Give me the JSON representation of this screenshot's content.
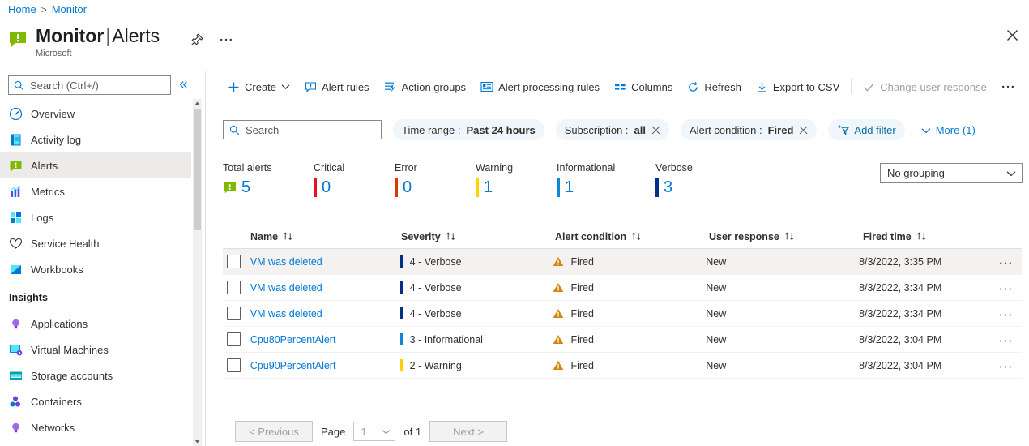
{
  "breadcrumb": {
    "home": "Home",
    "separator": ">",
    "current": "Monitor"
  },
  "header": {
    "title_main": "Monitor",
    "title_divider": "|",
    "title_sub": "Alerts",
    "subtitle": "Microsoft",
    "pin_icon": "pin-icon",
    "more_icon": "ellipsis-icon",
    "close_icon": "close-icon",
    "app_icon": "alert-green-icon"
  },
  "sidebar": {
    "search": {
      "placeholder": "Search (Ctrl+/)",
      "value": "",
      "icon": "search-icon"
    },
    "collapse_icon": "chevron-double-left-icon",
    "items": [
      {
        "label": "Overview",
        "icon": "overview-gauge-icon",
        "selected": false
      },
      {
        "label": "Activity log",
        "icon": "activity-log-book-icon",
        "selected": false
      },
      {
        "label": "Alerts",
        "icon": "alerts-green-icon",
        "selected": true
      },
      {
        "label": "Metrics",
        "icon": "metrics-chart-icon",
        "selected": false
      },
      {
        "label": "Logs",
        "icon": "logs-blocks-icon",
        "selected": false
      },
      {
        "label": "Service Health",
        "icon": "heart-pulse-icon",
        "selected": false
      },
      {
        "label": "Workbooks",
        "icon": "workbooks-icon",
        "selected": false
      }
    ],
    "section_label": "Insights",
    "insights": [
      {
        "label": "Applications",
        "icon": "application-bulb-icon"
      },
      {
        "label": "Virtual Machines",
        "icon": "virtual-machine-icon"
      },
      {
        "label": "Storage accounts",
        "icon": "storage-account-icon"
      },
      {
        "label": "Containers",
        "icon": "containers-icon"
      },
      {
        "label": "Networks",
        "icon": "networks-bulb-icon"
      }
    ]
  },
  "commandbar": [
    {
      "label": "Create",
      "icon": "plus-icon",
      "caret": true,
      "disabled": false
    },
    {
      "label": "Alert rules",
      "icon": "alert-rules-icon",
      "caret": false,
      "disabled": false
    },
    {
      "label": "Action groups",
      "icon": "action-groups-icon",
      "caret": false,
      "disabled": false
    },
    {
      "label": "Alert processing rules",
      "icon": "alert-processing-rules-icon",
      "caret": false,
      "disabled": false
    },
    {
      "label": "Columns",
      "icon": "columns-icon",
      "caret": false,
      "disabled": false
    },
    {
      "label": "Refresh",
      "icon": "refresh-icon",
      "caret": false,
      "disabled": false
    },
    {
      "label": "Export to CSV",
      "icon": "download-icon",
      "caret": false,
      "disabled": false
    },
    {
      "label": "Change user response",
      "icon": "checkmark-icon",
      "caret": false,
      "disabled": true
    }
  ],
  "commandbar_overflow_icon": "ellipsis-icon",
  "filters": {
    "search": {
      "placeholder": "Search",
      "value": "",
      "icon": "search-icon"
    },
    "pills": [
      {
        "key": "Time range :",
        "value": "Past 24 hours",
        "removable": false
      },
      {
        "key": "Subscription :",
        "value": "all",
        "removable": true
      },
      {
        "key": "Alert condition :",
        "value": "Fired",
        "removable": true
      }
    ],
    "add_filter": {
      "label": "Add filter",
      "icon": "add-filter-icon"
    },
    "more": {
      "label": "More (1)",
      "icon": "chevron-down-icon"
    }
  },
  "summary": {
    "tiles": [
      {
        "label": "Total alerts",
        "value": "5",
        "color": "#6bb700",
        "is_total": true
      },
      {
        "label": "Critical",
        "value": "0",
        "color": "#e81123",
        "is_total": false
      },
      {
        "label": "Error",
        "value": "0",
        "color": "#d83b01",
        "is_total": false
      },
      {
        "label": "Warning",
        "value": "1",
        "color": "#ffd100",
        "is_total": false
      },
      {
        "label": "Informational",
        "value": "1",
        "color": "#0d86d8",
        "is_total": false
      },
      {
        "label": "Verbose",
        "value": "3",
        "color": "#002f87",
        "is_total": false
      }
    ],
    "grouping": {
      "label": "No grouping",
      "icon": "chevron-down-icon"
    }
  },
  "table": {
    "columns": [
      {
        "label": "Name",
        "sort_icon": "sort-updown-icon"
      },
      {
        "label": "Severity",
        "sort_icon": "sort-updown-icon"
      },
      {
        "label": "Alert condition",
        "sort_icon": "sort-updown-icon"
      },
      {
        "label": "User response",
        "sort_icon": "sort-updown-icon"
      },
      {
        "label": "Fired time",
        "sort_icon": "sort-updown-icon"
      }
    ],
    "rows": [
      {
        "name": "VM was deleted",
        "severity": "4 - Verbose",
        "severity_color": "#002f87",
        "condition": "Fired",
        "condition_icon": "warning-triangle-icon",
        "response": "New",
        "fired_time": "8/3/2022, 3:35 PM",
        "menu_icon": "ellipsis-icon",
        "checked": false
      },
      {
        "name": "VM was deleted",
        "severity": "4 - Verbose",
        "severity_color": "#002f87",
        "condition": "Fired",
        "condition_icon": "warning-triangle-icon",
        "response": "New",
        "fired_time": "8/3/2022, 3:34 PM",
        "menu_icon": "ellipsis-icon",
        "checked": false
      },
      {
        "name": "VM was deleted",
        "severity": "4 - Verbose",
        "severity_color": "#002f87",
        "condition": "Fired",
        "condition_icon": "warning-triangle-icon",
        "response": "New",
        "fired_time": "8/3/2022, 3:34 PM",
        "menu_icon": "ellipsis-icon",
        "checked": false
      },
      {
        "name": "Cpu80PercentAlert",
        "severity": "3 - Informational",
        "severity_color": "#0d86d8",
        "condition": "Fired",
        "condition_icon": "warning-triangle-icon",
        "response": "New",
        "fired_time": "8/3/2022, 3:04 PM",
        "menu_icon": "ellipsis-icon",
        "checked": false
      },
      {
        "name": "Cpu90PercentAlert",
        "severity": "2 - Warning",
        "severity_color": "#ffd100",
        "condition": "Fired",
        "condition_icon": "warning-triangle-icon",
        "response": "New",
        "fired_time": "8/3/2022, 3:04 PM",
        "menu_icon": "ellipsis-icon",
        "checked": false
      }
    ]
  },
  "pagination": {
    "previous": "< Previous",
    "page_label": "Page",
    "page_value": "1",
    "of_label": "of 1",
    "next": "Next >",
    "caret_icon": "chevron-down-icon"
  },
  "colors": {
    "accent": "#0078d4",
    "pill_bg": "#eff6fc",
    "row_alt": "#f3f2f1",
    "warning_orange": "#d9820a"
  }
}
